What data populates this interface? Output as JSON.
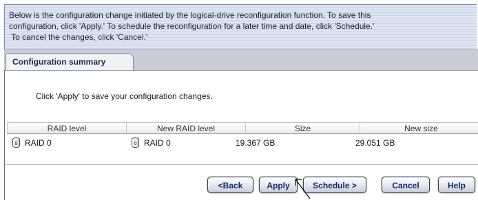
{
  "info": {
    "lines": [
      "Below is the configuration change initiated by the logical-drive reconfiguration function.  To save this",
      "configuration, click 'Apply.'  To schedule the reconfiguration for a later time and date, click 'Schedule.'",
      " To cancel the changes, click 'Cancel.'"
    ]
  },
  "tab": {
    "label": "Configuration summary"
  },
  "prompt": "Click 'Apply' to save your configuration changes.",
  "table": {
    "columns": [
      "RAID level",
      "New RAID level",
      "Size",
      "New size"
    ],
    "rows": [
      {
        "raid_icon_label": "0",
        "raid_level": "RAID 0",
        "new_raid_icon_label": "0",
        "new_raid_level": "RAID 0",
        "size": "19.367 GB",
        "new_size": "29.051 GB"
      }
    ]
  },
  "buttons": {
    "back": "<Back",
    "apply": "Apply",
    "schedule": "Schedule >",
    "cancel": "Cancel",
    "help": "Help"
  },
  "icons": {
    "raid": "disk-drive-icon",
    "cursor": "mouse-pointer-icon"
  },
  "colors": {
    "info_bg": "#dde4f2",
    "tab_bg": "#f1f2f6",
    "button_text": "#0d2a66"
  }
}
